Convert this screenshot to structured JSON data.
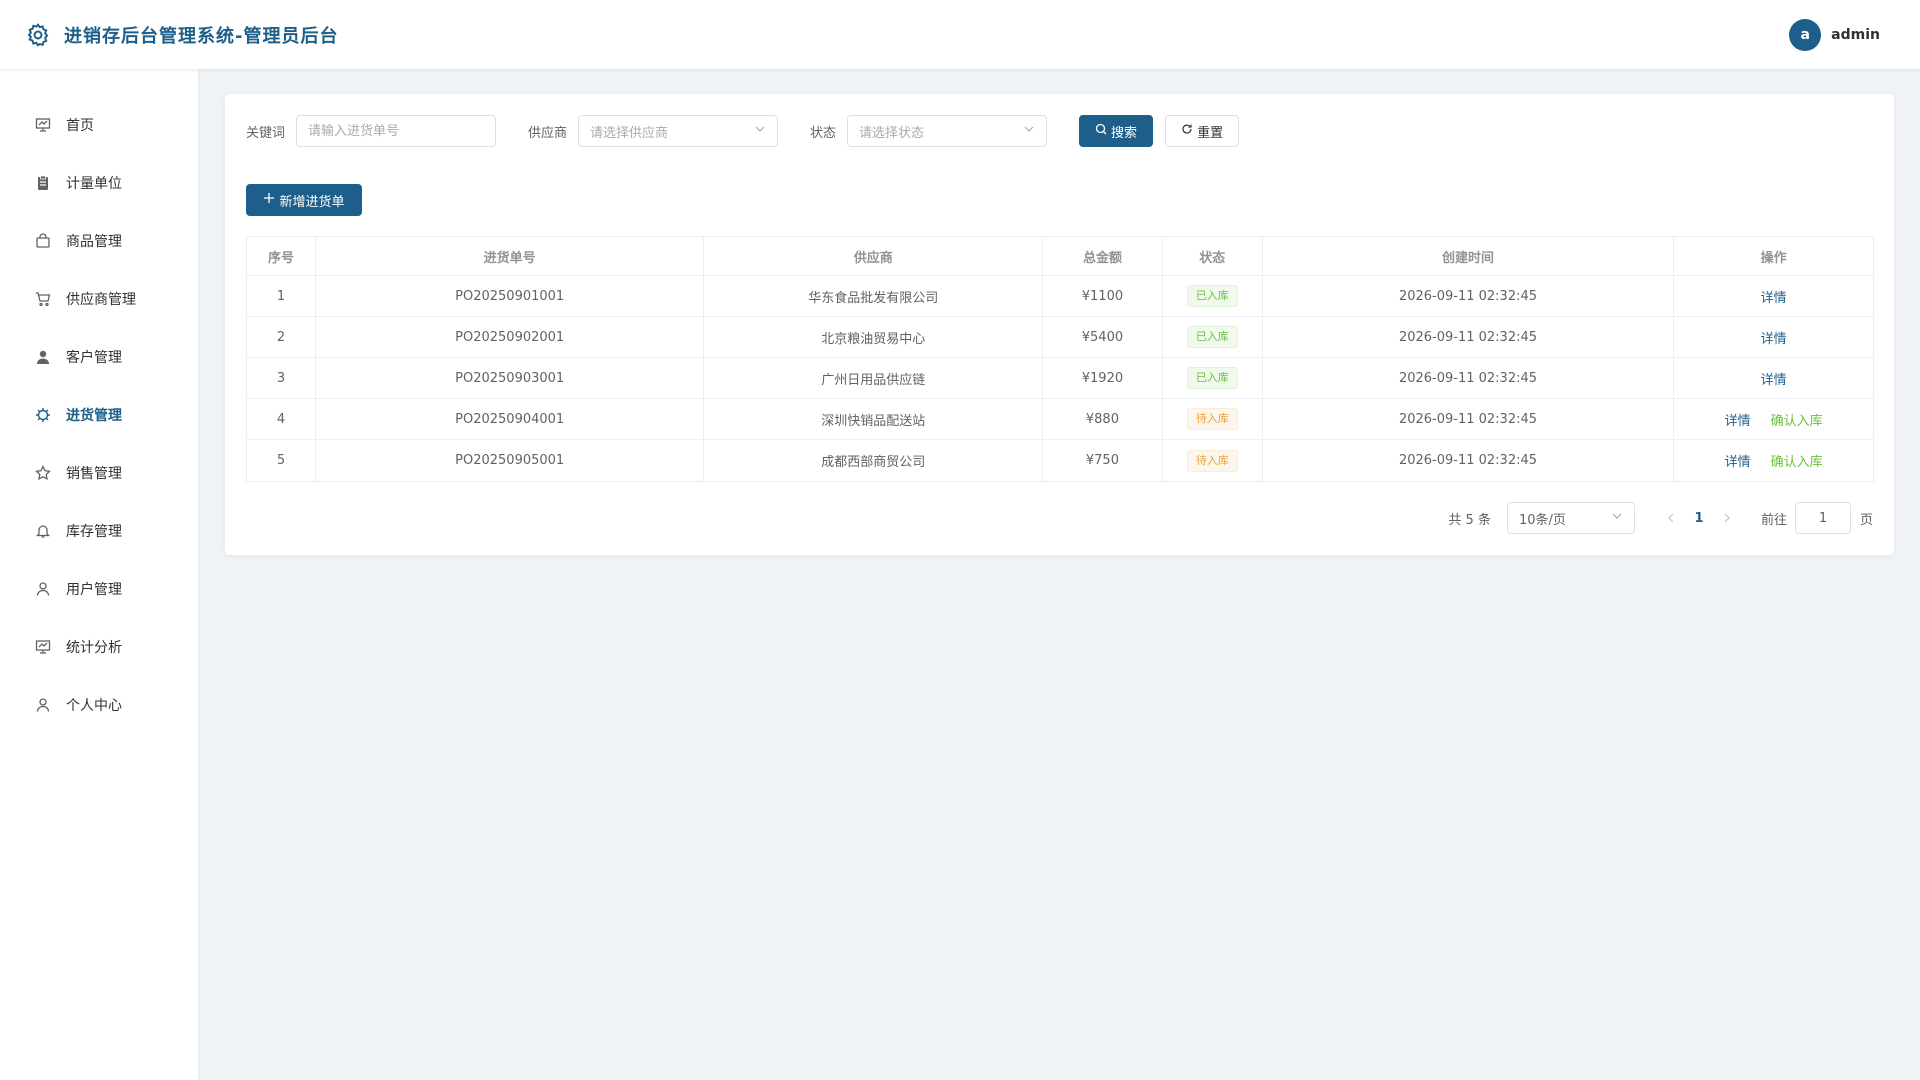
{
  "header": {
    "title": "进销存后台管理系统-管理员后台",
    "avatar_letter": "a",
    "user_name": "admin"
  },
  "sidebar": {
    "items": [
      {
        "label": "首页",
        "icon": "presentation-icon"
      },
      {
        "label": "计量单位",
        "icon": "clipboard-icon"
      },
      {
        "label": "商品管理",
        "icon": "shopping-bag-icon"
      },
      {
        "label": "供应商管理",
        "icon": "cart-icon"
      },
      {
        "label": "客户管理",
        "icon": "user-filled-icon"
      },
      {
        "label": "进货管理",
        "icon": "cog-icon",
        "active": true
      },
      {
        "label": "销售管理",
        "icon": "star-icon"
      },
      {
        "label": "库存管理",
        "icon": "bell-icon"
      },
      {
        "label": "用户管理",
        "icon": "user-outline-icon"
      },
      {
        "label": "统计分析",
        "icon": "presentation-icon"
      },
      {
        "label": "个人中心",
        "icon": "user-outline-icon"
      }
    ]
  },
  "filters": {
    "keyword_label": "关键词",
    "keyword_placeholder": "请输入进货单号",
    "supplier_label": "供应商",
    "supplier_placeholder": "请选择供应商",
    "status_label": "状态",
    "status_placeholder": "请选择状态",
    "search_label": "搜索",
    "reset_label": "重置"
  },
  "actions": {
    "add_label": "新增进货单"
  },
  "table": {
    "headers": [
      "序号",
      "进货单号",
      "供应商",
      "总金额",
      "状态",
      "创建时间",
      "操作"
    ],
    "rows": [
      {
        "no": "1",
        "order": "PO20250901001",
        "supplier": "华东食品批发有限公司",
        "amount": "¥1100",
        "status": "已入库",
        "time": "2026-09-11 02:32:45",
        "ops": [
          "详情"
        ]
      },
      {
        "no": "2",
        "order": "PO20250902001",
        "supplier": "北京粮油贸易中心",
        "amount": "¥5400",
        "status": "已入库",
        "time": "2026-09-11 02:32:45",
        "ops": [
          "详情"
        ]
      },
      {
        "no": "3",
        "order": "PO20250903001",
        "supplier": "广州日用品供应链",
        "amount": "¥1920",
        "status": "已入库",
        "time": "2026-09-11 02:32:45",
        "ops": [
          "详情"
        ]
      },
      {
        "no": "4",
        "order": "PO20250904001",
        "supplier": "深圳快销品配送站",
        "amount": "¥880",
        "status": "待入库",
        "time": "2026-09-11 02:32:45",
        "ops": [
          "详情",
          "确认入库"
        ]
      },
      {
        "no": "5",
        "order": "PO20250905001",
        "supplier": "成都西部商贸公司",
        "amount": "¥750",
        "status": "待入库",
        "time": "2026-09-11 02:32:45",
        "ops": [
          "详情",
          "确认入库"
        ]
      }
    ]
  },
  "pagination": {
    "total": "共 5 条",
    "page_size": "10条/页",
    "current_page": "1",
    "goto_label": "前往",
    "goto_value": "1",
    "page_suffix": "页"
  },
  "colors": {
    "primary": "#1d5f8a",
    "success": "#67c23a",
    "warning": "#e6a23c"
  }
}
